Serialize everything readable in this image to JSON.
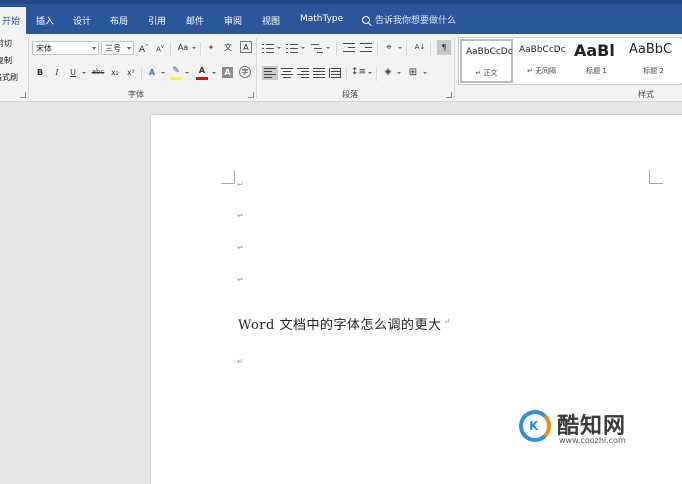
{
  "tabs": {
    "home": "开始",
    "insert": "插入",
    "design": "设计",
    "layout": "布局",
    "references": "引用",
    "mailings": "邮件",
    "review": "审阅",
    "view": "视图",
    "mathtype": "MathType"
  },
  "tell_me": "告诉我你想要做什么",
  "clipboard": {
    "cut": "剪切",
    "copy": "复制",
    "format_painter": "格式刷"
  },
  "font": {
    "font_name": "宋体",
    "font_size": "三号",
    "grow": "A",
    "shrink": "A",
    "change_case": "Aa",
    "bold": "B",
    "italic": "I",
    "underline": "U",
    "strikethrough": "abc",
    "subscript": "x₂",
    "superscript": "x²",
    "text_effects": "A",
    "font_color": "A",
    "char_shading": "A",
    "enclose": "字",
    "phonetic": "文",
    "char_border": "A",
    "group_label": "字体"
  },
  "paragraph": {
    "sort": "A↓",
    "show_marks": "¶",
    "group_label": "段落"
  },
  "styles": {
    "items": [
      {
        "sample": "AaBbCcDc",
        "name": "↵ 正文"
      },
      {
        "sample": "AaBbCcDc",
        "name": "↵ 无间隔"
      },
      {
        "sample": "AaBl",
        "name": "标题 1"
      },
      {
        "sample": "AaBbC",
        "name": "标题 2"
      }
    ],
    "group_label": "样式"
  },
  "document": {
    "body_text": "Word 文档中的字体怎么调的更大",
    "para_mark": "↵"
  },
  "watermark": {
    "logo_letter": "K",
    "title": "酷知网",
    "url": "www.coozhi.com"
  },
  "colors": {
    "accent": "#2b579a",
    "ribbon_bg": "#f3f3f3",
    "highlight": "#ffff00",
    "font_color_bar": "#ff0000"
  }
}
